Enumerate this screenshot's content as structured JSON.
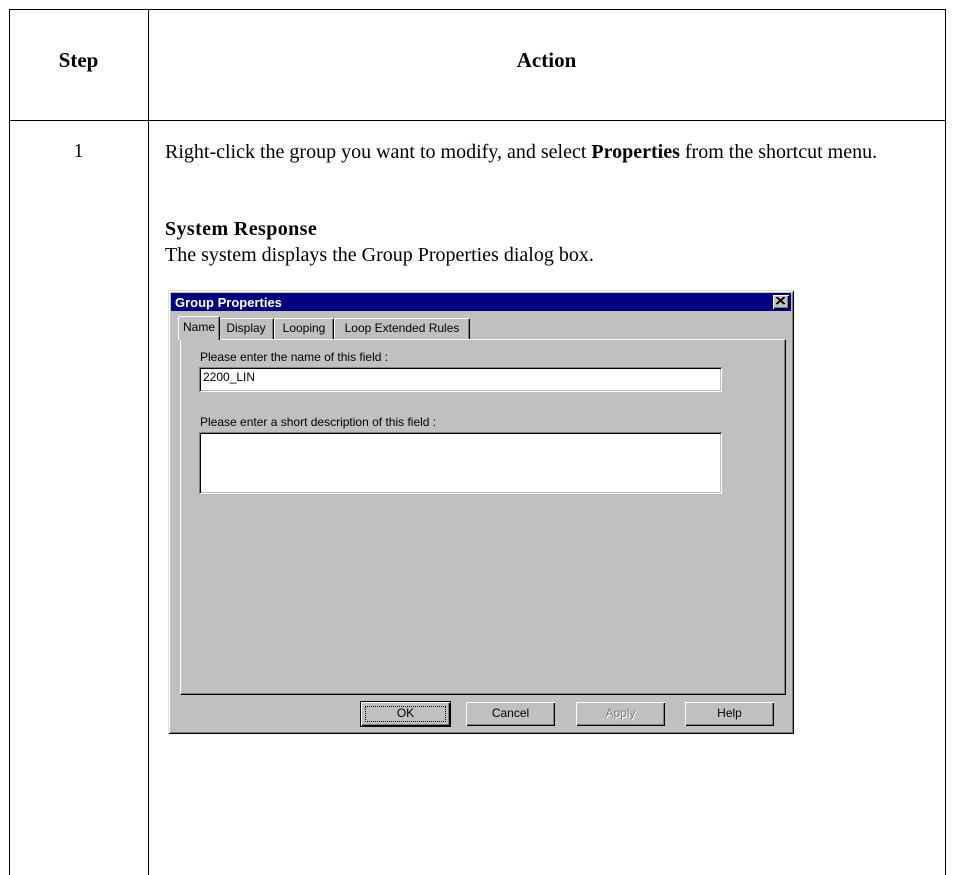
{
  "table": {
    "header_step": "Step",
    "header_action": "Action",
    "step_number": "1",
    "action_before": "Right-click the group you want to modify, and select ",
    "action_bold": "Properties",
    "action_after": " from the shortcut menu.",
    "response_title": "System Response",
    "response_text": "The system displays the Group Properties dialog box."
  },
  "dialog": {
    "title": "Group Properties",
    "tabs": [
      "Name",
      "Display",
      "Looping",
      "Loop Extended Rules"
    ],
    "active_tab": "Name",
    "name_label": "Please enter the name of this field :",
    "name_value": "2200_LIN",
    "desc_label": "Please enter a short description of this field :",
    "desc_value": "",
    "buttons": {
      "ok": "OK",
      "cancel": "Cancel",
      "apply": "Apply",
      "help": "Help"
    },
    "colors": {
      "titlebar": "#000080",
      "face": "#c0c0c0"
    }
  }
}
